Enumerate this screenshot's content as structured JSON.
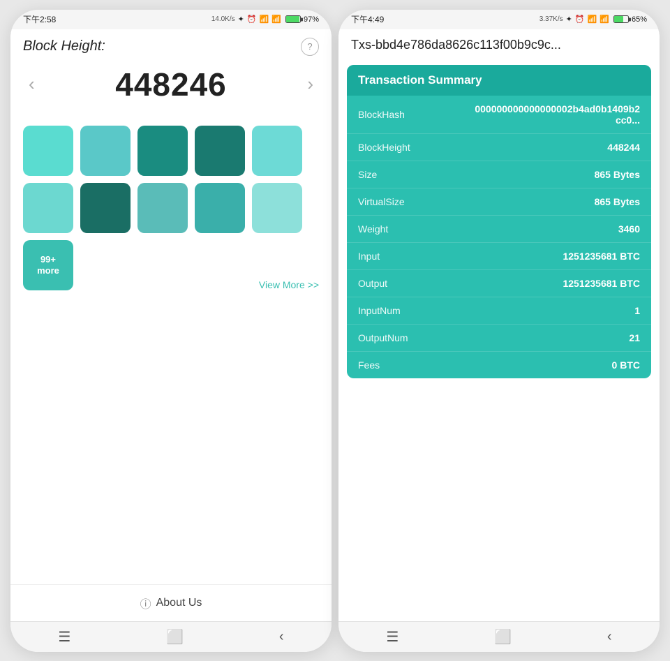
{
  "phone1": {
    "statusBar": {
      "time": "下午2:58",
      "speed": "14.0K/s",
      "battery_percent": "97%",
      "battery_fill": 97
    },
    "header": {
      "title": "Block Height:",
      "help_label": "?"
    },
    "nav": {
      "block_number": "448246",
      "left_arrow": "‹",
      "right_arrow": "›"
    },
    "blocks": {
      "rows": [
        [
          {
            "color": "#5adcd0"
          },
          {
            "color": "#5ac8c8"
          },
          {
            "color": "#1a8c80"
          },
          {
            "color": "#1a7a70"
          },
          {
            "color": "#6ddad6"
          }
        ],
        [
          {
            "color": "#6cd8d0"
          },
          {
            "color": "#1a6e64"
          },
          {
            "color": "#5abcb8"
          },
          {
            "color": "#3aafaa"
          },
          {
            "color": "#8de0da"
          }
        ]
      ],
      "more_label": "99+\nmore",
      "view_more": "View More >>"
    },
    "about_us": {
      "label": "About Us"
    },
    "navbar": {
      "menu": "☰",
      "square": "⬜",
      "back": "‹"
    }
  },
  "phone2": {
    "statusBar": {
      "time": "下午4:49",
      "speed": "3.37K/s",
      "battery_percent": "65%",
      "battery_fill": 65
    },
    "tx_id": "Txs-bbd4e786da8626c113f00b9c9c...",
    "summary": {
      "title": "Transaction Summary",
      "rows": [
        {
          "label": "BlockHash",
          "value": "000000000000000002b4ad0b1409b2cc0..."
        },
        {
          "label": "BlockHeight",
          "value": "448244"
        },
        {
          "label": "Size",
          "value": "865 Bytes"
        },
        {
          "label": "VirtualSize",
          "value": "865 Bytes"
        },
        {
          "label": "Weight",
          "value": "3460"
        },
        {
          "label": "Input",
          "value": "1251235681 BTC"
        },
        {
          "label": "Output",
          "value": "1251235681 BTC"
        },
        {
          "label": "InputNum",
          "value": "1"
        },
        {
          "label": "OutputNum",
          "value": "21"
        },
        {
          "label": "Fees",
          "value": "0 BTC"
        }
      ]
    },
    "navbar": {
      "menu": "☰",
      "square": "⬜",
      "back": "‹"
    }
  }
}
